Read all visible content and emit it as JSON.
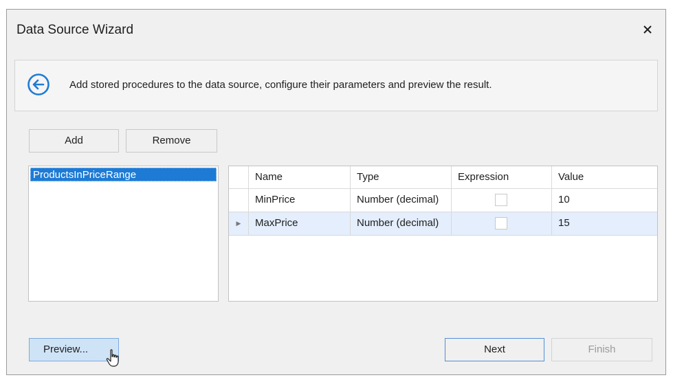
{
  "window": {
    "title": "Data Source Wizard",
    "close_glyph": "✕"
  },
  "header": {
    "description": "Add stored procedures to the data source, configure their parameters and preview the result.",
    "accent_color": "#1e7bd5"
  },
  "toolbar": {
    "add_label": "Add",
    "remove_label": "Remove"
  },
  "procedures": {
    "items": [
      "ProductsInPriceRange"
    ],
    "selected": "ProductsInPriceRange"
  },
  "parameters": {
    "columns": [
      "Name",
      "Type",
      "Expression",
      "Value"
    ],
    "rows": [
      {
        "indicator": "",
        "name": "MinPrice",
        "type": "Number (decimal)",
        "expression": false,
        "value": "10"
      },
      {
        "indicator": "▶",
        "name": "MaxPrice",
        "type": "Number (decimal)",
        "expression": false,
        "value": "15"
      }
    ]
  },
  "footer": {
    "preview_label": "Preview...",
    "next_label": "Next",
    "finish_label": "Finish"
  }
}
